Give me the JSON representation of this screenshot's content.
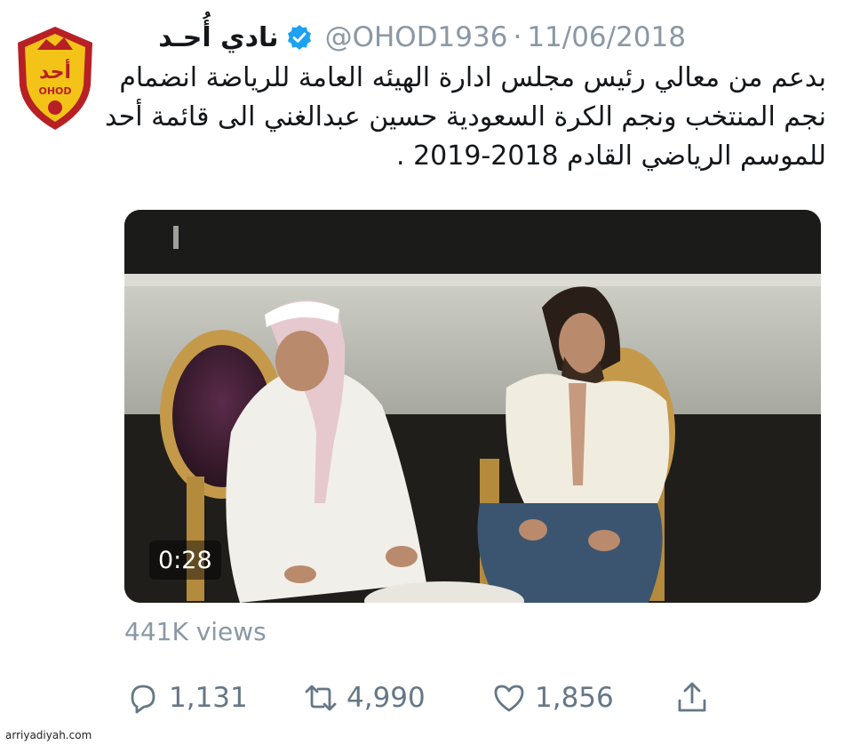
{
  "tweet": {
    "display_name": "نادي أُحـد",
    "handle": "@OHOD1936",
    "separator": "·",
    "date": "11/06/2018",
    "text_lines": [
      "بدعم من معالي رئيس مجلس ادارة الهيئه العامة للرياضة انضمام",
      "نجم المنتخب ونجم الكرة السعودية حسين عبدالغني الى قائمة أحد",
      "للموسم الرياضي القادم 2018-2019 ."
    ],
    "avatar": {
      "logo_text_ar": "أحد",
      "logo_text_en": "OHOD"
    },
    "video": {
      "duration": "0:28"
    },
    "views": "441K views",
    "actions": {
      "reply_count": "1,131",
      "retweet_count": "4,990",
      "like_count": "1,856"
    },
    "icons": [
      "verified-badge-icon",
      "reply-icon",
      "retweet-icon",
      "like-icon",
      "share-icon"
    ]
  },
  "colors": {
    "text": "#14171a",
    "muted": "#8a98a5",
    "verified": "#1da1f2",
    "logo_yellow": "#f3c417",
    "logo_red": "#b72025"
  },
  "watermark": "arriyadiyah.com"
}
